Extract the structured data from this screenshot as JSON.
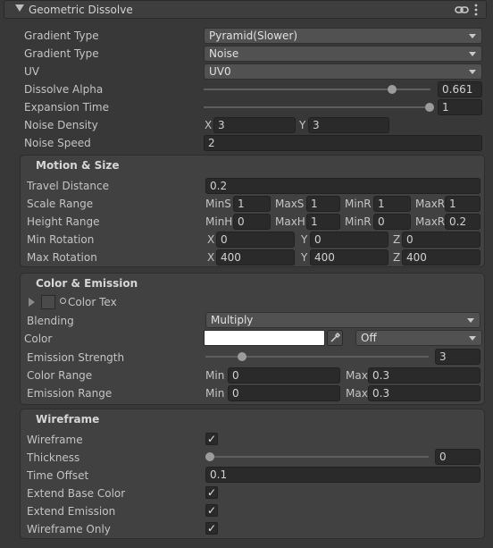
{
  "header": {
    "title": "Geometric Dissolve"
  },
  "main": {
    "gradient_type_1": {
      "label": "Gradient Type",
      "value": "Pyramid(Slower)"
    },
    "gradient_type_2": {
      "label": "Gradient Type",
      "value": "Noise"
    },
    "uv": {
      "label": "UV",
      "value": "UV0"
    },
    "dissolve_alpha": {
      "label": "Dissolve Alpha",
      "value": "0.661",
      "fraction": 0.83
    },
    "expansion_time": {
      "label": "Expansion Time",
      "value": "1",
      "fraction": 1.0
    },
    "noise_density": {
      "label": "Noise Density",
      "x_label": "X",
      "x": "3",
      "y_label": "Y",
      "y": "3"
    },
    "noise_speed": {
      "label": "Noise Speed",
      "value": "2"
    }
  },
  "motion": {
    "title": "Motion & Size",
    "travel_distance": {
      "label": "Travel Distance",
      "value": "0.2"
    },
    "scale_range": {
      "label": "Scale Range",
      "a_label": "MinS",
      "a": "1",
      "b_label": "MaxS",
      "b": "1",
      "c_label": "MinR",
      "c": "1",
      "d_label": "MaxR",
      "d": "1"
    },
    "height_range": {
      "label": "Height Range",
      "a_label": "MinH",
      "a": "0",
      "b_label": "MaxH",
      "b": "1",
      "c_label": "MinR",
      "c": "0",
      "d_label": "MaxR",
      "d": "0.2"
    },
    "min_rotation": {
      "label": "Min Rotation",
      "x_label": "X",
      "x": "0",
      "y_label": "Y",
      "y": "0",
      "z_label": "Z",
      "z": "0"
    },
    "max_rotation": {
      "label": "Max Rotation",
      "x_label": "X",
      "x": "400",
      "y_label": "Y",
      "y": "400",
      "z_label": "Z",
      "z": "400"
    }
  },
  "color": {
    "title": "Color & Emission",
    "color_tex": {
      "label": "Color Tex",
      "icon": "circle-dot-icon"
    },
    "blending": {
      "label": "Blending",
      "value": "Multiply"
    },
    "color": {
      "label": "Color",
      "swatch": "#ffffff",
      "hdr": "Off"
    },
    "emission_strength": {
      "label": "Emission Strength",
      "value": "3",
      "fraction": 0.2
    },
    "color_range": {
      "label": "Color Range",
      "min_label": "Min",
      "min": "0",
      "max_label": "Max",
      "max": "0.3"
    },
    "emission_range": {
      "label": "Emission Range",
      "min_label": "Min",
      "min": "0",
      "max_label": "Max",
      "max": "0.3"
    }
  },
  "wireframe": {
    "title": "Wireframe",
    "wireframe": {
      "label": "Wireframe",
      "checked": true
    },
    "thickness": {
      "label": "Thickness",
      "value": "0",
      "fraction": 0.0
    },
    "time_offset": {
      "label": "Time Offset",
      "value": "0.1"
    },
    "extend_base_color": {
      "label": "Extend Base Color",
      "checked": true
    },
    "extend_emission": {
      "label": "Extend Emission",
      "checked": true
    },
    "wireframe_only": {
      "label": "Wireframe Only",
      "checked": true
    }
  },
  "icons": {
    "link": "link-icon",
    "menu": "kebab-menu-icon",
    "check": "✓",
    "eyedropper": "eyedropper-icon"
  }
}
